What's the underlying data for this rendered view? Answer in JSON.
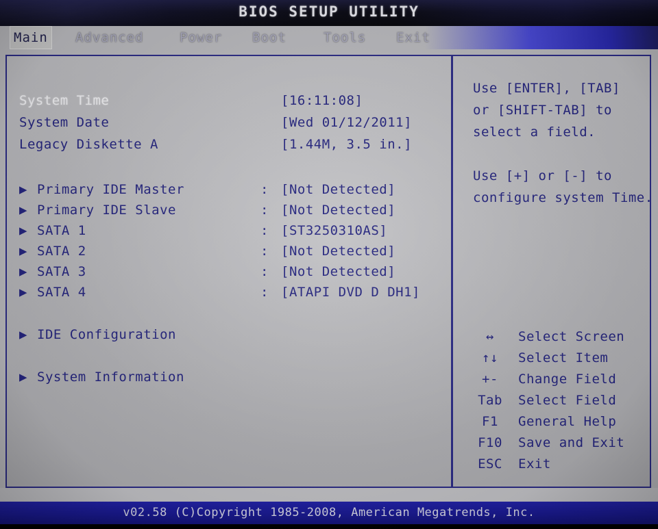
{
  "header": {
    "title": "BIOS SETUP UTILITY",
    "tabs": [
      {
        "label": "Main",
        "active": true
      },
      {
        "label": "Advanced",
        "active": false
      },
      {
        "label": "Power",
        "active": false
      },
      {
        "label": "Boot",
        "active": false
      },
      {
        "label": "Tools",
        "active": false
      },
      {
        "label": "Exit",
        "active": false
      }
    ]
  },
  "main": {
    "settings": [
      {
        "label": "System Time",
        "value": "[16:11:08]",
        "selected": true
      },
      {
        "label": "System Date",
        "value": "[Wed 01/12/2011]",
        "selected": false
      },
      {
        "label": "Legacy Diskette A",
        "value": "[1.44M, 3.5 in.]",
        "selected": false
      }
    ],
    "drives": [
      {
        "bullet": "▶",
        "label": "Primary IDE Master",
        "colon": ":",
        "value": "[Not Detected]"
      },
      {
        "bullet": "▶",
        "label": "Primary IDE Slave",
        "colon": ":",
        "value": "[Not Detected]"
      },
      {
        "bullet": "▶",
        "label": "SATA 1",
        "colon": ":",
        "value": "[ST3250310AS]"
      },
      {
        "bullet": "▶",
        "label": "SATA 2",
        "colon": ":",
        "value": "[Not Detected]"
      },
      {
        "bullet": "▶",
        "label": "SATA 3",
        "colon": ":",
        "value": "[Not Detected]"
      },
      {
        "bullet": "▶",
        "label": "SATA 4",
        "colon": ":",
        "value": "[ATAPI   DVD D  DH1]"
      }
    ],
    "submenus": [
      {
        "bullet": "▶",
        "label": "IDE Configuration"
      },
      {
        "bullet": "▶",
        "label": "System Information"
      }
    ]
  },
  "help": {
    "lines": [
      "Use [ENTER], [TAB]",
      "or [SHIFT-TAB] to",
      "select a field.",
      "",
      "Use [+] or [-] to",
      "configure system Time."
    ]
  },
  "keys": [
    {
      "symbol": "↔",
      "desc": "Select Screen"
    },
    {
      "symbol": "↑↓",
      "desc": "Select Item"
    },
    {
      "symbol": "+-",
      "desc": "Change Field"
    },
    {
      "symbol": "Tab",
      "desc": "Select Field"
    },
    {
      "symbol": "F1",
      "desc": "General Help"
    },
    {
      "symbol": "F10",
      "desc": "Save and Exit"
    },
    {
      "symbol": "ESC",
      "desc": "Exit"
    }
  ],
  "footer": {
    "text": "v02.58 (C)Copyright 1985-2008, American Megatrends, Inc."
  },
  "colors": {
    "panel_bg": "#b8b8bc",
    "text_blue": "#25257f",
    "border_blue": "#2b2b86",
    "selected_text": "#f2f2f5",
    "footer_blue": "#1a1a92",
    "active_tab_bg": "#c6c6c6"
  }
}
